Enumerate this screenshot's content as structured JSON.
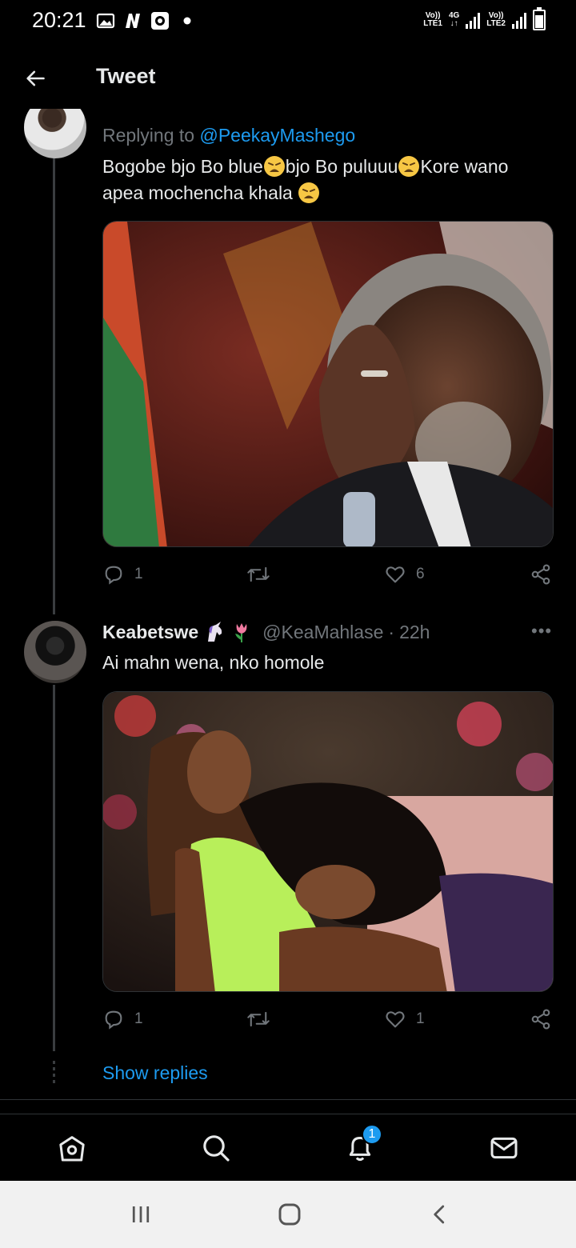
{
  "status_bar": {
    "time": "20:21",
    "sim1_label_top": "Vo))",
    "sim1_label_bottom": "LTE1",
    "network": "4G",
    "sim2_label_top": "Vo))",
    "sim2_label_bottom": "LTE2",
    "icons": [
      "gallery-icon",
      "n-notification-icon",
      "shield-app-icon",
      "dot-icon",
      "signal-icon",
      "battery-icon"
    ]
  },
  "header": {
    "title": "Tweet",
    "back_icon": "back-arrow-icon"
  },
  "tweets": [
    {
      "reply_prefix": "Replying to",
      "reply_mention": "@PeekayMashego",
      "text_part1": "Bogobe bjo Bo blue",
      "text_part2": "bjo Bo puluuu",
      "text_part3": "Kore wano apea mochencha khala ",
      "emoji": "weary-face-emoji",
      "media": "photo",
      "reply_count": "1",
      "retweet_count": "",
      "like_count": "6"
    },
    {
      "author_name": "Keabetswe",
      "author_emojis": [
        "unicorn-emoji",
        "tulip-emoji"
      ],
      "handle": "@KeaMahlase",
      "separator": "·",
      "time": "22h",
      "more": "•••",
      "text": "Ai mahn wena, nko homole",
      "media": "photo",
      "reply_count": "1",
      "retweet_count": "",
      "like_count": "1"
    }
  ],
  "show_replies": "Show replies",
  "bottom_nav": {
    "items": [
      "home-icon",
      "search-icon",
      "notifications-icon",
      "messages-icon"
    ],
    "notification_badge": "1"
  },
  "system_nav": {
    "items": [
      "recent-apps-icon",
      "home-circle-icon",
      "back-chevron-icon"
    ]
  },
  "colors": {
    "background": "#000000",
    "text": "#e7e9ea",
    "secondary": "#71767b",
    "accent": "#1d9bf0",
    "border": "#2f3336"
  }
}
